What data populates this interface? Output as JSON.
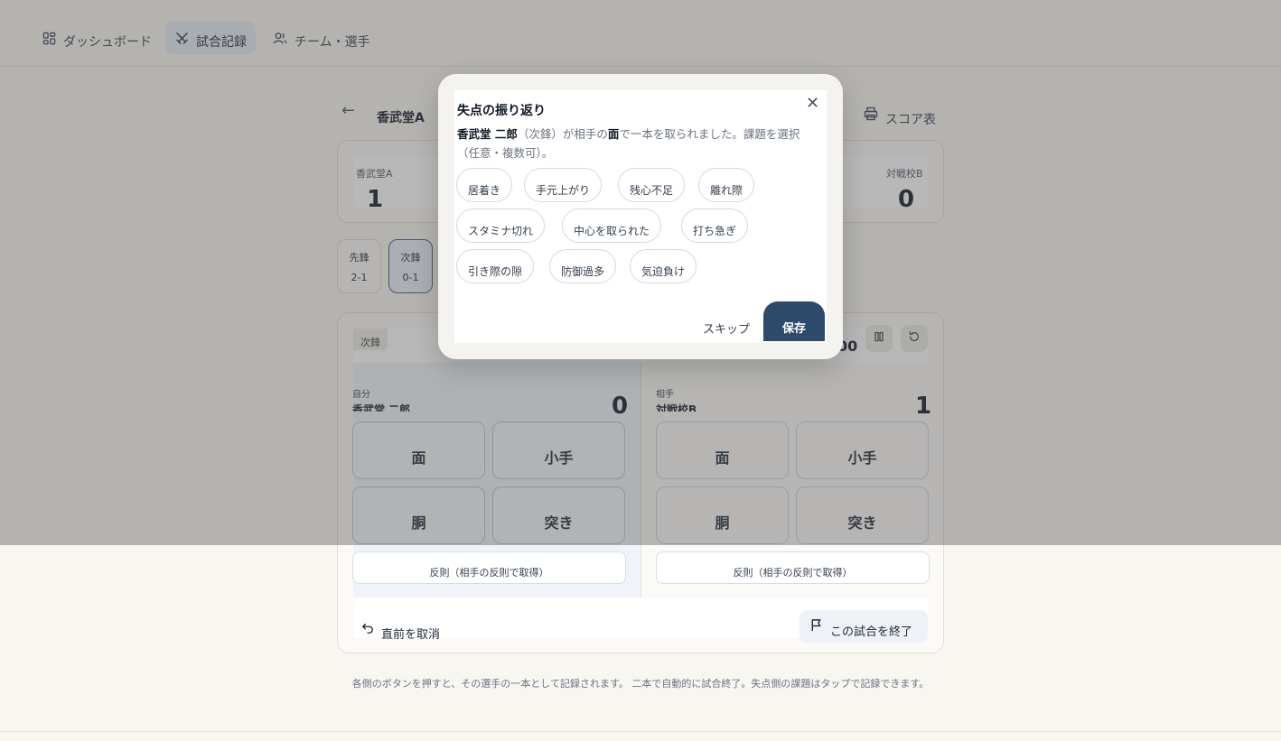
{
  "nav": {
    "items": [
      {
        "label": "ダッシュボード",
        "icon": "dashboard-grid-icon"
      },
      {
        "label": "試合記録",
        "icon": "crossed-swords-icon",
        "active": true
      },
      {
        "label": "チーム・選手",
        "icon": "users-icon"
      }
    ]
  },
  "match": {
    "title": "香武堂A",
    "print_label": "スコア表",
    "team_a": {
      "name": "香武堂A",
      "score": "1"
    },
    "team_b": {
      "name": "対戦校B",
      "score": "0"
    }
  },
  "bouts": [
    {
      "position": "先鋒",
      "score": "2-1"
    },
    {
      "position": "次鋒",
      "score": "0-1",
      "active": true
    }
  ],
  "panel": {
    "bout_badge": "次鋒",
    "timer": "00",
    "self": {
      "label": "自分",
      "player": "香武堂 二郎",
      "score": "0"
    },
    "opponent": {
      "label": "相手",
      "player": "対戦校B",
      "score": "1"
    },
    "techniques": [
      "面",
      "小手",
      "胴",
      "突き"
    ],
    "foul_label": "反則（相手の反則で取得）",
    "undo_label": "直前を取消",
    "end_label": "この試合を終了"
  },
  "help_text": "各側のボタンを押すと、その選手の一本として記録されます。 二本で自動的に試合終了。失点側の課題はタップで記録できます。",
  "modal": {
    "title": "失点の振り返り",
    "player": "香武堂 二郎",
    "position_paren": "（次鋒）",
    "desc_mid": "が相手の",
    "technique": "面",
    "desc_end": "で一本を取られました。課題を選択（任意・複数可）。",
    "chips": [
      "居着き",
      "手元上がり",
      "残心不足",
      "離れ際",
      "スタミナ切れ",
      "中心を取られた",
      "打ち急ぎ",
      "引き際の隙",
      "防御過多",
      "気迫負け"
    ],
    "skip_label": "スキップ",
    "save_label": "保存"
  },
  "colors": {
    "accent": "#2d4a6b",
    "background": "#f8f6f1",
    "overlay": "#555555"
  }
}
